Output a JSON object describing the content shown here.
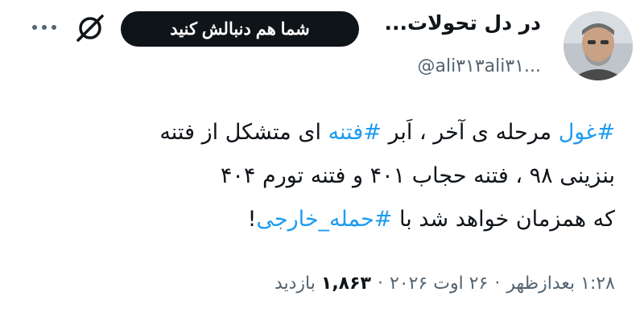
{
  "author": {
    "name": "در دل تحولات...",
    "handle": "@ali۳۱۳ali۳۱..."
  },
  "follow_button": "شما هم دنبالش کنید",
  "icons": {
    "grok": "grok-slash-icon",
    "more": "more-horizontal-icon"
  },
  "tweet": {
    "line1": {
      "tag1": "#غول",
      "text1": " مرحله ی آخر ، اَبر ",
      "tag2": "#فتنه",
      "text2": " ای متشکل از فتنه"
    },
    "line2": "بنزینی ۹۸ ، فتنه حجاب ۴۰۱ و فتنه تورم ۴۰۴",
    "line3": {
      "text": "که همزمان خواهد شد با ",
      "tag": "#حمله_خارجی",
      "end": "!"
    }
  },
  "meta": {
    "time": "۱:۲۸ بعدازظهر",
    "date": "۲۶ اوت ۲۰۲۶",
    "views_count": "۱,۸۶۳",
    "views_label": "بازدید",
    "separator": "·"
  },
  "colors": {
    "accent": "#1d9bf0",
    "text": "#0f1419",
    "muted": "#536471"
  }
}
